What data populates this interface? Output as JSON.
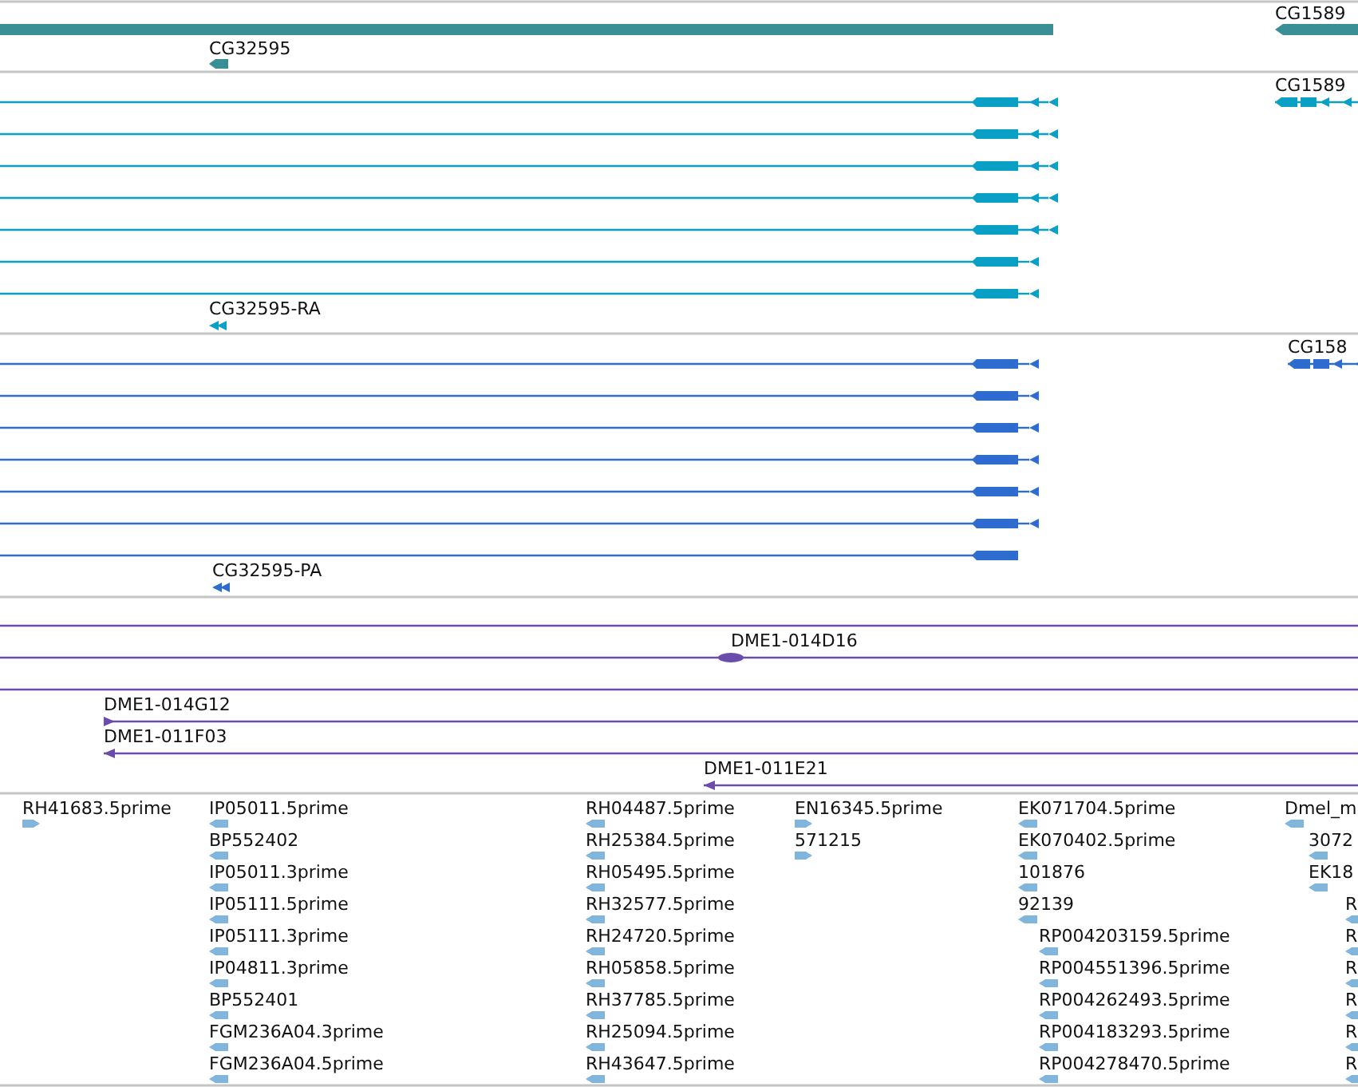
{
  "tracks": [
    {
      "kind": "gene",
      "color": "#3a8f96",
      "labels": [
        "CG32595",
        "CG1589"
      ]
    },
    {
      "kind": "transcript",
      "color": "#0aa0c6",
      "labels": [
        "CG32595-RA",
        "CG1589"
      ]
    },
    {
      "kind": "cds",
      "color": "#2f6ccf",
      "labels": [
        "CG32595-PA",
        "CG158"
      ]
    },
    {
      "kind": "clone",
      "color": "#6a4caa",
      "labels": [
        "DME1-014D16",
        "DME1-014G12",
        "DME1-011F03",
        "DME1-011E21"
      ]
    },
    {
      "kind": "est",
      "color": "#80b6dc",
      "columns": [
        {
          "items": [
            {
              "label": "RH41683.5prime",
              "reverse": false
            }
          ]
        },
        {
          "items": [
            {
              "label": "IP05011.5prime",
              "reverse": true
            },
            {
              "label": "BP552402",
              "reverse": true
            },
            {
              "label": "IP05011.3prime",
              "reverse": true
            },
            {
              "label": "IP05111.5prime",
              "reverse": true
            },
            {
              "label": "IP05111.3prime",
              "reverse": true
            },
            {
              "label": "IP04811.3prime",
              "reverse": true
            },
            {
              "label": "BP552401",
              "reverse": true
            },
            {
              "label": "FGM236A04.3prime",
              "reverse": true
            },
            {
              "label": "FGM236A04.5prime",
              "reverse": true
            }
          ]
        },
        {
          "items": [
            {
              "label": "RH04487.5prime",
              "reverse": true
            },
            {
              "label": "RH25384.5prime",
              "reverse": true
            },
            {
              "label": "RH05495.5prime",
              "reverse": true
            },
            {
              "label": "RH32577.5prime",
              "reverse": true
            },
            {
              "label": "RH24720.5prime",
              "reverse": true
            },
            {
              "label": "RH05858.5prime",
              "reverse": true
            },
            {
              "label": "RH37785.5prime",
              "reverse": true
            },
            {
              "label": "RH25094.5prime",
              "reverse": true
            },
            {
              "label": "RH43647.5prime",
              "reverse": true
            }
          ]
        },
        {
          "items": [
            {
              "label": "EN16345.5prime",
              "reverse": false
            },
            {
              "label": "571215",
              "reverse": false
            }
          ]
        },
        {
          "items": [
            {
              "label": "EK071704.5prime",
              "reverse": true
            },
            {
              "label": "EK070402.5prime",
              "reverse": true
            },
            {
              "label": "101876",
              "reverse": true
            },
            {
              "label": "92139",
              "reverse": true
            }
          ]
        },
        {
          "items": [
            {
              "label": "RP004203159.5prime",
              "reverse": true
            },
            {
              "label": "RP004551396.5prime",
              "reverse": true
            },
            {
              "label": "RP004262493.5prime",
              "reverse": true
            },
            {
              "label": "RP004183293.5prime",
              "reverse": true
            },
            {
              "label": "RP004278470.5prime",
              "reverse": true
            }
          ]
        },
        {
          "items": [
            {
              "label": "Dmel_m",
              "reverse": true
            }
          ]
        },
        {
          "items": [
            {
              "label": "3072",
              "reverse": true
            },
            {
              "label": "EK18",
              "reverse": true
            }
          ]
        },
        {
          "items": [
            {
              "label": "R",
              "reverse": true
            },
            {
              "label": "R",
              "reverse": true
            },
            {
              "label": "R",
              "reverse": true
            },
            {
              "label": "R",
              "reverse": true
            },
            {
              "label": "R",
              "reverse": true
            },
            {
              "label": "R",
              "reverse": true
            }
          ]
        }
      ]
    }
  ]
}
